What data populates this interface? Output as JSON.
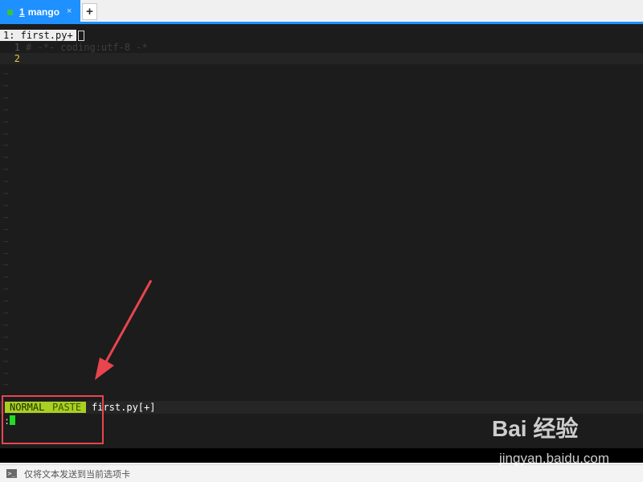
{
  "tabs": {
    "active_number": "1",
    "active_label": "mango",
    "close_symbol": "×",
    "add_symbol": "+",
    "status_color": "#39c23e",
    "accent": "#1e90ff"
  },
  "vim": {
    "tabline_label": "1: first.py+",
    "lines": [
      {
        "number": "1",
        "text": "# -*- coding:utf-8 -*"
      },
      {
        "number": "2",
        "text": ""
      }
    ],
    "tilde": "~",
    "status": {
      "mode": "NORMAL",
      "paste": "PASTE",
      "file": "first.py[+]"
    },
    "cmd_prompt": ":",
    "mode_color": "#a9d022",
    "cursor_color": "#22dd22"
  },
  "bottom_bar": {
    "icon": "terminal-icon",
    "text": "仅将文本发送到当前选项卡"
  },
  "watermark": {
    "logo_text": "Bai 经验",
    "url": "jingyan.baidu.com"
  }
}
